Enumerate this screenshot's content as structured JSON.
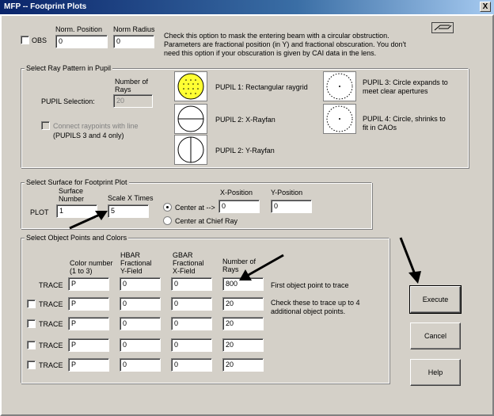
{
  "window": {
    "title": "MFP -- Footprint Plots",
    "close_label": "X"
  },
  "obs": {
    "checkbox_label": "OBS",
    "norm_position_label": "Norm. Position",
    "norm_position_value": "0",
    "norm_radius_label": "Norm Radius",
    "norm_radius_value": "0",
    "help_text_1": "Check this option to mask the entering beam with a circular obstruction.",
    "help_text_2": "Parameters are fractional position (in Y) and fractional obscuration. You don't",
    "help_text_3": "need this option if your obscuration is given by CAI data in the lens."
  },
  "ray_pattern": {
    "group_title": "Select Ray Pattern in Pupil",
    "number_of_label_1": "Number of",
    "number_of_label_2": "Rays",
    "pupil_selection_label": "PUPIL Selection:",
    "number_of_rays_value": "20",
    "connect_label": "Connect raypoints with line",
    "connect_note": "(PUPILS 3 and 4 only)",
    "pupil1_label": "PUPIL 1: Rectangular raygrid",
    "pupil2x_label": "PUPIL 2: X-Rayfan",
    "pupil2y_label": "PUPIL 2: Y-Rayfan",
    "pupil3_label_1": "PUPIL 3: Circle expands to",
    "pupil3_label_2": "meet clear apertures",
    "pupil4_label_1": "PUPIL 4: Circle, shrinks to",
    "pupil4_label_2": "fit in CAOs",
    "selected_color": "#ffff33"
  },
  "surface": {
    "group_title": "Select Surface for Footprint Plot",
    "surface_number_label_1": "Surface",
    "surface_number_label_2": "Number",
    "plot_label": "PLOT",
    "surface_number_value": "1",
    "scale_label": "Scale X Times",
    "scale_value": "5",
    "center_at_label": "Center at -->",
    "center_chief_label": "Center at Chief Ray",
    "x_position_label": "X-Position",
    "x_position_value": "0",
    "y_position_label": "Y-Position",
    "y_position_value": "0"
  },
  "objects": {
    "group_title": "Select Object Points and Colors",
    "col_color_1": "Color number",
    "col_color_2": "(1 to 3)",
    "col_hbar_1": "HBAR",
    "col_hbar_2": "Fractional",
    "col_hbar_3": "Y-Field",
    "col_gbar_1": "GBAR",
    "col_gbar_2": "Fractional",
    "col_gbar_3": "X-Field",
    "col_rays_1": "Number of",
    "col_rays_2": "Rays",
    "trace_label": "TRACE",
    "note_first": "First object point to trace",
    "note_check_1": "Check these to trace up to 4",
    "note_check_2": "additional object points.",
    "rows": [
      {
        "color": "P",
        "hbar": "0",
        "gbar": "0",
        "rays": "800"
      },
      {
        "color": "P",
        "hbar": "0",
        "gbar": "0",
        "rays": "20"
      },
      {
        "color": "P",
        "hbar": "0",
        "gbar": "0",
        "rays": "20"
      },
      {
        "color": "P",
        "hbar": "0",
        "gbar": "0",
        "rays": "20"
      },
      {
        "color": "P",
        "hbar": "0",
        "gbar": "0",
        "rays": "20"
      }
    ]
  },
  "buttons": {
    "execute": "Execute",
    "cancel": "Cancel",
    "help": "Help"
  },
  "icons": {
    "top_right": "lens-icon"
  }
}
